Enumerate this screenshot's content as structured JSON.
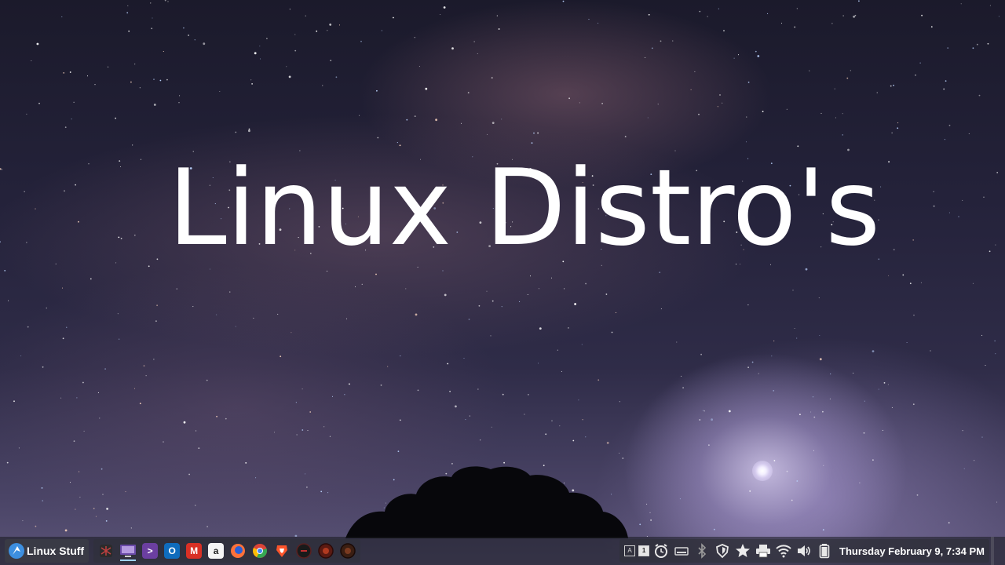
{
  "desktop": {
    "wallpaper_text": "Linux Distro's"
  },
  "taskbar": {
    "menu_label": "Linux Stuff",
    "menu_icon": "menu-logo-icon",
    "launchers": [
      {
        "name": "spider-app-icon",
        "color": "#2b2b2b"
      },
      {
        "name": "computer-icon",
        "color": "#6a4aa8"
      },
      {
        "name": "terminal-icon",
        "color": "#6b3fa0"
      },
      {
        "name": "outlook-icon",
        "color": "#0f6cbd"
      },
      {
        "name": "gmail-icon",
        "color": "#d93025"
      },
      {
        "name": "amazon-icon",
        "color": "#f5f5f5"
      },
      {
        "name": "firefox-icon",
        "color": "#ff7139"
      },
      {
        "name": "chrome-icon",
        "color": "#34a853"
      },
      {
        "name": "brave-icon",
        "color": "#fb542b"
      },
      {
        "name": "dark-circle-app-icon",
        "color": "#3a1010"
      },
      {
        "name": "red-orb-app-icon",
        "color": "#5a1a12"
      },
      {
        "name": "dark-orb-app-icon",
        "color": "#3a1e12"
      }
    ],
    "tray": {
      "keyboard_layout_label": "A",
      "workspace_label": "1",
      "icons": [
        "keyboard-layout-icon",
        "workspace-icon",
        "alarm-clock-icon",
        "drive-icon",
        "bluetooth-icon",
        "shield-icon",
        "star-icon",
        "printer-icon",
        "wifi-icon",
        "volume-icon",
        "battery-icon"
      ]
    },
    "clock": "Thursday February  9,  7:34 PM"
  },
  "colors": {
    "taskbar_bg": "#16181e",
    "text": "#ffffff"
  }
}
